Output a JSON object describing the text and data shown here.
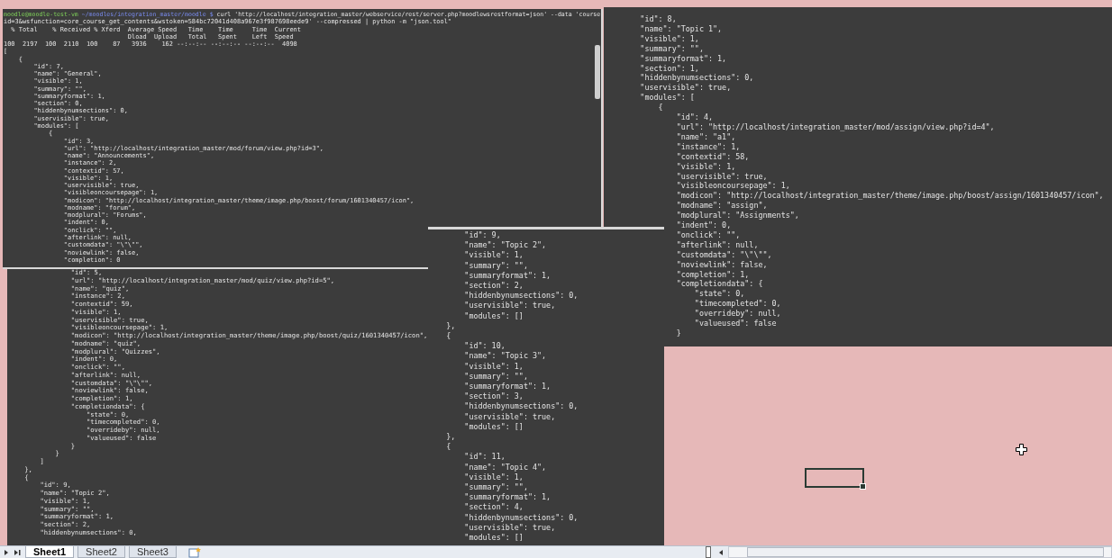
{
  "pasted_screenshots": [
    {
      "prompt": {
        "user_host": "moodle@moodle-test-vm",
        "path": "~/moodles/integration_master/moodle $",
        "command": "curl 'http://localhost/integration_master/webservice/rest/server.php?moodlewsrestformat=json' --data 'course"
      },
      "lines": [
        "id=3&wsfunction=core_course_get_contents&wstoken=584bc72041d408a967e3f987698eede9' --compressed | python -m \"json.tool\"",
        "  % Total    % Received % Xferd  Average Speed   Time    Time     Time  Current",
        "                                 Dload  Upload   Total   Spent    Left  Speed",
        "100  2197  100  2110  100    87   3936    162 --:--:-- --:--:-- --:--:--  4098",
        "[",
        "    {",
        "        \"id\": 7,",
        "        \"name\": \"General\",",
        "        \"visible\": 1,",
        "        \"summary\": \"\",",
        "        \"summaryformat\": 1,",
        "        \"section\": 0,",
        "        \"hiddenbynumsections\": 0,",
        "        \"uservisible\": true,",
        "        \"modules\": [",
        "            {",
        "                \"id\": 3,",
        "                \"url\": \"http://localhost/integration_master/mod/forum/view.php?id=3\",",
        "                \"name\": \"Announcements\",",
        "                \"instance\": 2,",
        "                \"contextid\": 57,",
        "                \"visible\": 1,",
        "                \"uservisible\": true,",
        "                \"visibleoncoursepage\": 1,",
        "                \"modicon\": \"http://localhost/integration_master/theme/image.php/boost/forum/1601340457/icon\",",
        "                \"modname\": \"forum\",",
        "                \"modplural\": \"Forums\",",
        "                \"indent\": 0,",
        "                \"onclick\": \"\",",
        "                \"afterlink\": null,",
        "                \"customdata\": \"\\\"\\\"\",",
        "                \"noviewlink\": false,",
        "                \"completion\": 0"
      ]
    },
    {
      "lines": [
        "                \"id\": 5,",
        "                \"url\": \"http://localhost/integration_master/mod/quiz/view.php?id=5\",",
        "                \"name\": \"quiz\",",
        "                \"instance\": 2,",
        "                \"contextid\": 59,",
        "                \"visible\": 1,",
        "                \"uservisible\": true,",
        "                \"visibleoncoursepage\": 1,",
        "                \"modicon\": \"http://localhost/integration_master/theme/image.php/boost/quiz/1601340457/icon\",",
        "                \"modname\": \"quiz\",",
        "                \"modplural\": \"Quizzes\",",
        "                \"indent\": 0,",
        "                \"onclick\": \"\",",
        "                \"afterlink\": null,",
        "                \"customdata\": \"\\\"\\\"\",",
        "                \"noviewlink\": false,",
        "                \"completion\": 1,",
        "                \"completiondata\": {",
        "                    \"state\": 0,",
        "                    \"timecompleted\": 0,",
        "                    \"overrideby\": null,",
        "                    \"valueused\": false",
        "                }",
        "            }",
        "        ]",
        "    },",
        "    {",
        "        \"id\": 9,",
        "        \"name\": \"Topic 2\",",
        "        \"visible\": 1,",
        "        \"summary\": \"\",",
        "        \"summaryformat\": 1,",
        "        \"section\": 2,",
        "        \"hiddenbynumsections\": 0,"
      ]
    },
    {
      "lines": [
        "        \"id\": 8,",
        "        \"name\": \"Topic 1\",",
        "        \"visible\": 1,",
        "        \"summary\": \"\",",
        "        \"summaryformat\": 1,",
        "        \"section\": 1,",
        "        \"hiddenbynumsections\": 0,",
        "        \"uservisible\": true,",
        "        \"modules\": [",
        "            {",
        "                \"id\": 4,",
        "                \"url\": \"http://localhost/integration_master/mod/assign/view.php?id=4\",",
        "                \"name\": \"a1\",",
        "                \"instance\": 1,",
        "                \"contextid\": 58,",
        "                \"visible\": 1,",
        "                \"uservisible\": true,",
        "                \"visibleoncoursepage\": 1,",
        "                \"modicon\": \"http://localhost/integration_master/theme/image.php/boost/assign/1601340457/icon\",",
        "                \"modname\": \"assign\",",
        "                \"modplural\": \"Assignments\",",
        "                \"indent\": 0,",
        "                \"onclick\": \"\",",
        "                \"afterlink\": null,",
        "                \"customdata\": \"\\\"\\\"\",",
        "                \"noviewlink\": false,",
        "                \"completion\": 1,",
        "                \"completiondata\": {",
        "                    \"state\": 0,",
        "                    \"timecompleted\": 0,",
        "                    \"overrideby\": null,",
        "                    \"valueused\": false",
        "                }"
      ]
    },
    {
      "lines": [
        "        \"id\": 9,",
        "        \"name\": \"Topic 2\",",
        "        \"visible\": 1,",
        "        \"summary\": \"\",",
        "        \"summaryformat\": 1,",
        "        \"section\": 2,",
        "        \"hiddenbynumsections\": 0,",
        "        \"uservisible\": true,",
        "        \"modules\": []",
        "    },",
        "    {",
        "        \"id\": 10,",
        "        \"name\": \"Topic 3\",",
        "        \"visible\": 1,",
        "        \"summary\": \"\",",
        "        \"summaryformat\": 1,",
        "        \"section\": 3,",
        "        \"hiddenbynumsections\": 0,",
        "        \"uservisible\": true,",
        "        \"modules\": []",
        "    },",
        "    {",
        "        \"id\": 11,",
        "        \"name\": \"Topic 4\",",
        "        \"visible\": 1,",
        "        \"summary\": \"\",",
        "        \"summaryformat\": 1,",
        "        \"section\": 4,",
        "        \"hiddenbynumsections\": 0,",
        "        \"uservisible\": true,",
        "        \"modules\": []"
      ]
    }
  ],
  "sheet_tabs": [
    {
      "label": "Sheet1",
      "selected": true
    },
    {
      "label": "Sheet2",
      "selected": false
    },
    {
      "label": "Sheet3",
      "selected": false
    }
  ]
}
